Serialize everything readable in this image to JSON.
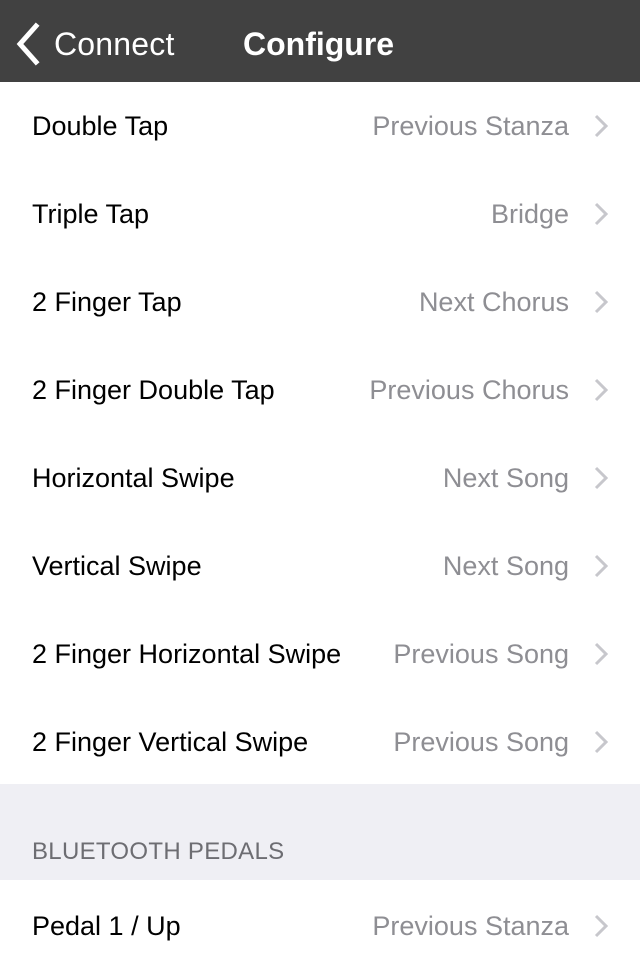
{
  "navbar": {
    "back_label": "Connect",
    "back_icon": "chevron-left-icon",
    "title": "Configure"
  },
  "gestures": [
    {
      "label": "Double Tap",
      "value": "Previous Stanza"
    },
    {
      "label": "Triple Tap",
      "value": "Bridge"
    },
    {
      "label": "2 Finger Tap",
      "value": "Next Chorus"
    },
    {
      "label": "2 Finger Double Tap",
      "value": "Previous Chorus"
    },
    {
      "label": "Horizontal Swipe",
      "value": "Next Song"
    },
    {
      "label": "Vertical Swipe",
      "value": "Next Song"
    },
    {
      "label": "2 Finger Horizontal Swipe",
      "value": "Previous Song"
    },
    {
      "label": "2 Finger Vertical Swipe",
      "value": "Previous Song"
    }
  ],
  "bluetooth_section": {
    "title": "BLUETOOTH PEDALS",
    "items": [
      {
        "label": "Pedal 1 / Up",
        "value": "Previous Stanza"
      }
    ]
  },
  "colors": {
    "navbar_bg": "#414141",
    "section_bg": "#efeff4",
    "value_text": "#8e8e93",
    "chevron": "#c7c7cc"
  }
}
